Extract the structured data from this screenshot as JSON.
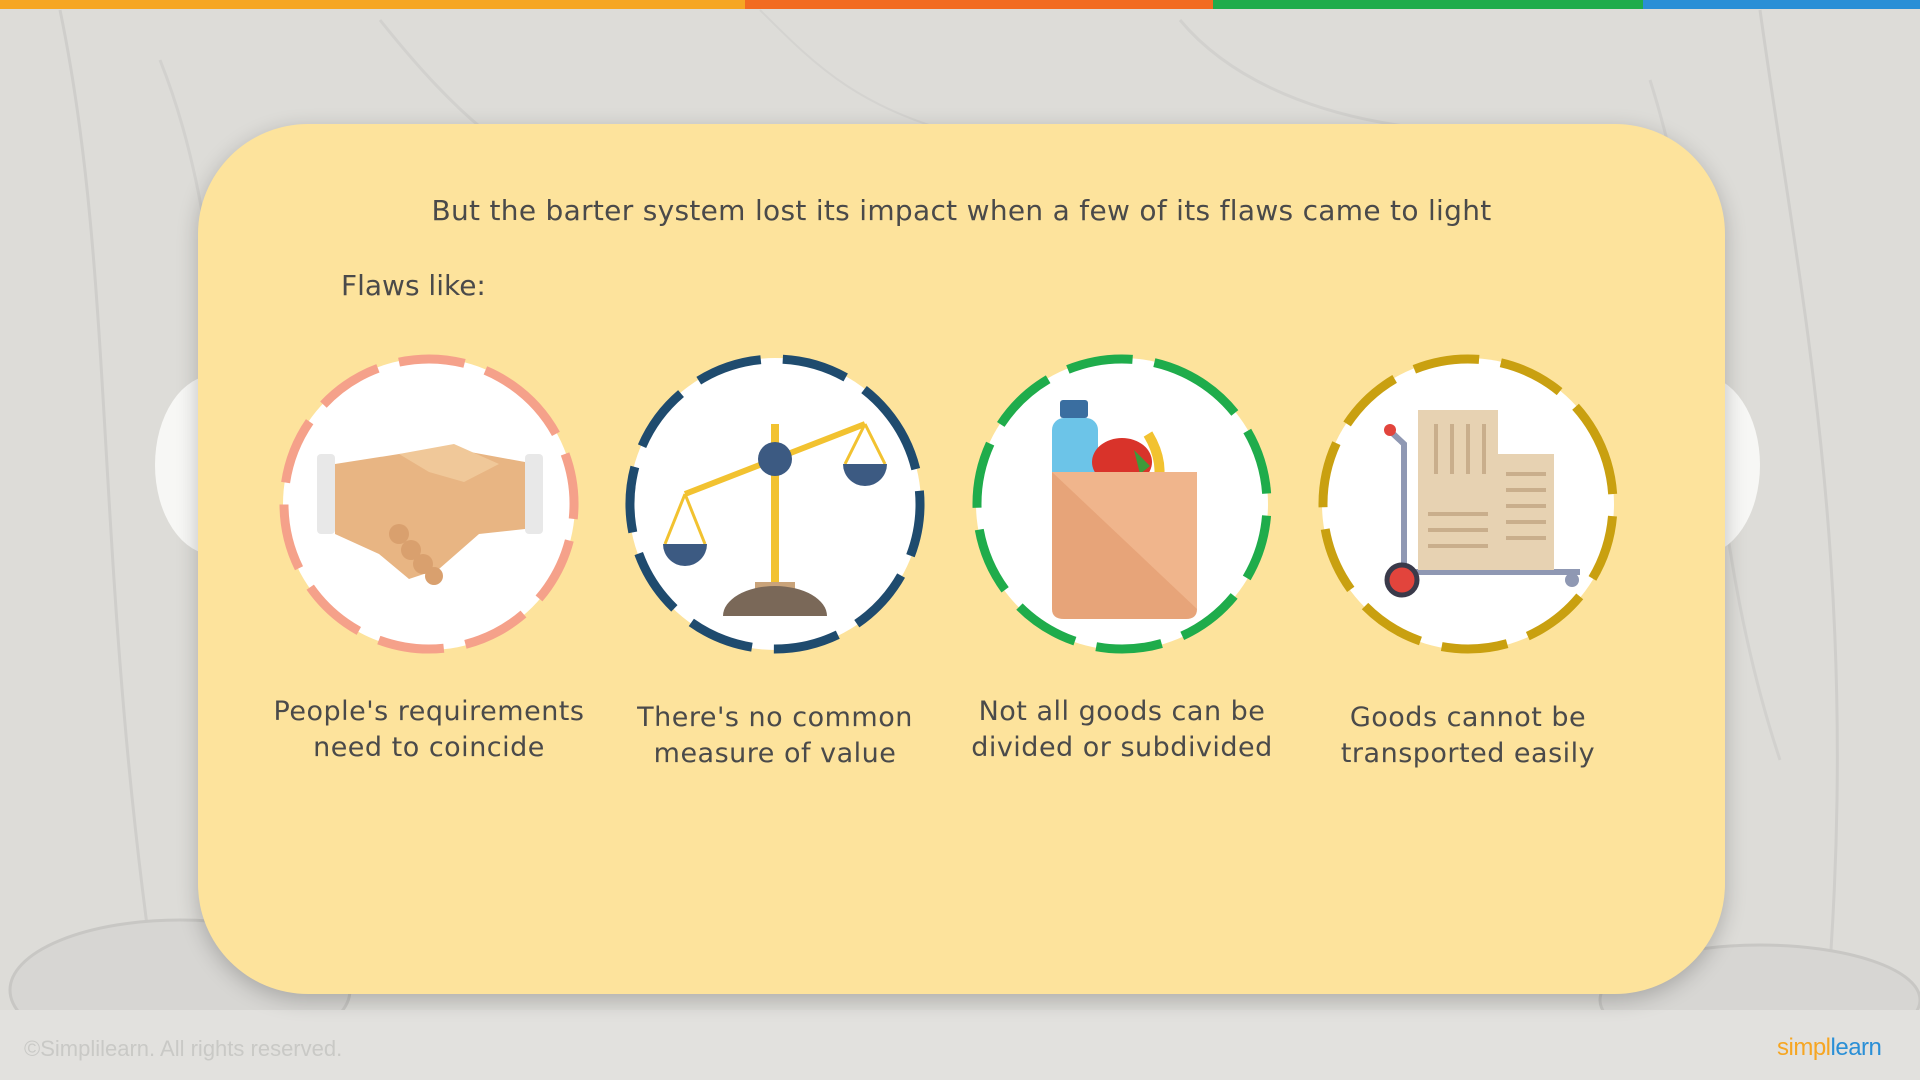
{
  "slide": {
    "headline": "But the barter system lost its impact when a few of its flaws came to light",
    "flaws_label": "Flaws like:",
    "flaws": [
      {
        "label": "People's requirements need to coincide",
        "icon": "handshake-icon",
        "ring_color": "#f5a18a"
      },
      {
        "label": "There's no common measure of value",
        "icon": "balance-scale-icon",
        "ring_color": "#1f4b6e"
      },
      {
        "label": "Not all goods can be divided or subdivided",
        "icon": "grocery-bag-icon",
        "ring_color": "#1fac4b"
      },
      {
        "label": "Goods cannot be transported easily",
        "icon": "hand-truck-icon",
        "ring_color": "#c9a010"
      }
    ]
  },
  "footer": {
    "copyright": "©Simplilearn. All rights reserved.",
    "logo_part1": "simpl",
    "logo_part2": "learn"
  },
  "colors": {
    "card": "#fde39c",
    "stripe": [
      "#f6a623",
      "#f26b21",
      "#1fac4b",
      "#2a8fd6"
    ],
    "logo_orange": "#f6a623",
    "logo_blue": "#2a8fd6"
  }
}
